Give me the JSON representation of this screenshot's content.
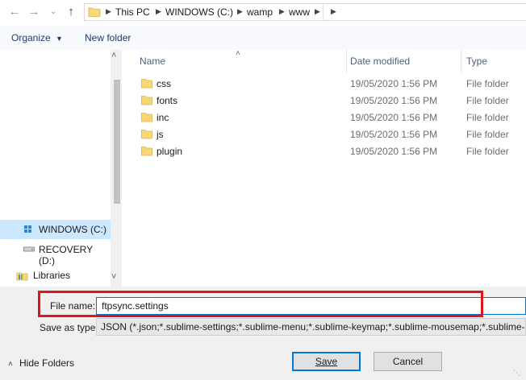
{
  "address_bar": {
    "crumbs": [
      "This PC",
      "WINDOWS (C:)",
      "wamp",
      "www"
    ]
  },
  "toolbar": {
    "organize_label": "Organize",
    "new_folder_label": "New folder"
  },
  "nav": {
    "items": [
      {
        "label": "WINDOWS (C:)",
        "icon": "drive-icon",
        "selected": true
      },
      {
        "label": "RECOVERY (D:)",
        "icon": "drive-icon",
        "selected": false
      },
      {
        "label": "Libraries",
        "icon": "libraries-icon",
        "selected": false
      }
    ]
  },
  "list": {
    "columns": {
      "name": "Name",
      "date": "Date modified",
      "type": "Type"
    },
    "rows": [
      {
        "name": "css",
        "date": "19/05/2020 1:56 PM",
        "type": "File folder"
      },
      {
        "name": "fonts",
        "date": "19/05/2020 1:56 PM",
        "type": "File folder"
      },
      {
        "name": "inc",
        "date": "19/05/2020 1:56 PM",
        "type": "File folder"
      },
      {
        "name": "js",
        "date": "19/05/2020 1:56 PM",
        "type": "File folder"
      },
      {
        "name": "plugin",
        "date": "19/05/2020 1:56 PM",
        "type": "File folder"
      }
    ]
  },
  "file_name": {
    "label": "File name:",
    "value": "ftpsync.settings"
  },
  "save_as_type": {
    "label": "Save as type:",
    "value": "JSON (*.json;*.sublime-settings;*.sublime-menu;*.sublime-keymap;*.sublime-mousemap;*.sublime-"
  },
  "footer": {
    "hide_folders_label": "Hide Folders",
    "save_label": "Save",
    "cancel_label": "Cancel"
  },
  "colors": {
    "highlight_box": "#e0141e",
    "selected_nav": "#cce8ff",
    "folder": "#f8d775"
  }
}
